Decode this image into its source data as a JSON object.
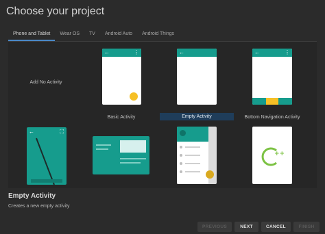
{
  "title": "Choose your project",
  "tabs": [
    "Phone and Tablet",
    "Wear OS",
    "TV",
    "Android Auto",
    "Android Things"
  ],
  "templates": {
    "no_activity": "Add No Activity",
    "basic": "Basic Activity",
    "empty": "Empty Activity",
    "bottom_nav": "Bottom Navigation Activity"
  },
  "icons": {
    "back": "←",
    "menu": "⋮",
    "fullscreen": "⛶"
  },
  "selected": {
    "title": "Empty Activity",
    "description": "Creates a new empty activity"
  },
  "buttons": {
    "previous": "PREVIOUS",
    "next": "NEXT",
    "cancel": "CANCEL",
    "finish": "FINISH"
  },
  "colors": {
    "teal": "#169c8d",
    "accent": "#f6c026",
    "selection": "#1f3d5a"
  }
}
